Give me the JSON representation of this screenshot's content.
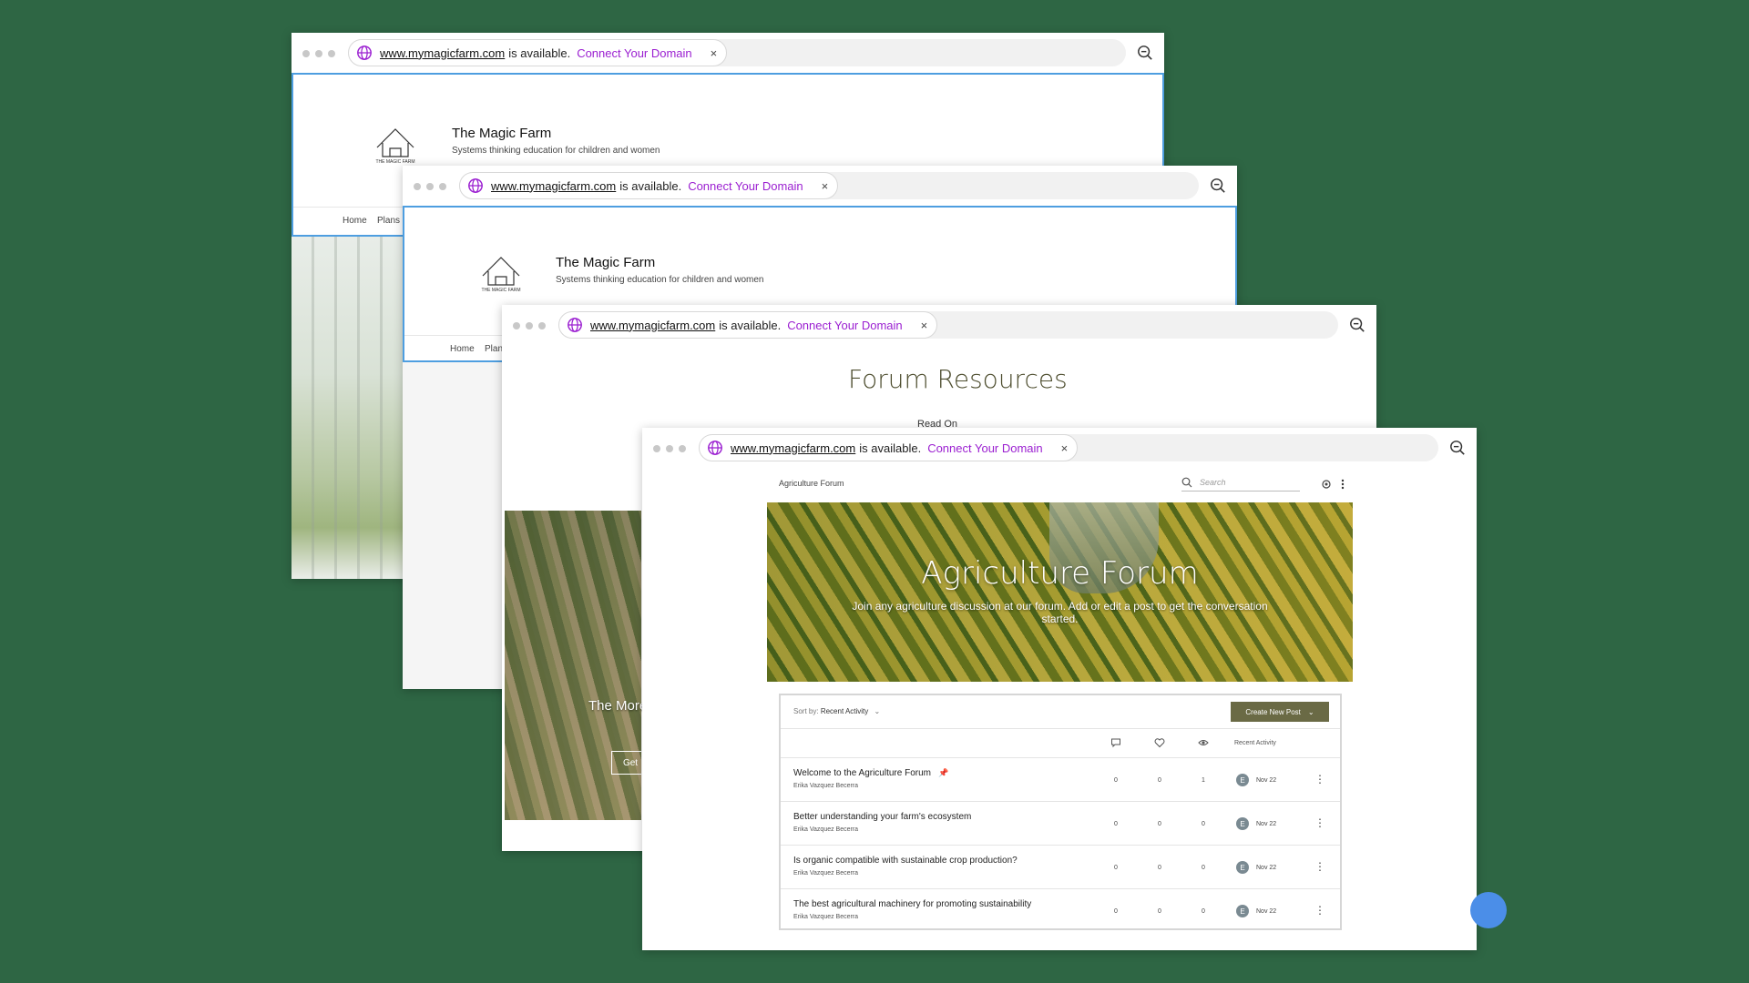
{
  "colors": {
    "background": "#2e6644",
    "accent_connect": "#9b1fd1",
    "button": "#6a6a45"
  },
  "browser": {
    "domain": "www.mymagicfarm.com",
    "available_text": "is available.",
    "connect_label": "Connect Your Domain",
    "close_glyph": "×"
  },
  "site": {
    "brand": "The Magic Farm",
    "tagline": "Systems thinking education for children and women",
    "logo_text": "THE MAGIC FARM",
    "nav": [
      "Home",
      "Plans &",
      "Plans"
    ]
  },
  "resources": {
    "title": "Forum Resources",
    "read_on": "Read On",
    "overlay_text": "The More",
    "overlay_button": "Get"
  },
  "forum": {
    "breadcrumb": "Agriculture Forum",
    "search_placeholder": "Search",
    "hero_title": "Agriculture Forum",
    "hero_desc": "Join any agriculture discussion at our forum. Add or edit a post to get the conversation started.",
    "sort_label": "Sort by:",
    "sort_value": "Recent Activity",
    "create_post": "Create New Post",
    "col_recent": "Recent Activity",
    "posts": [
      {
        "title": "Welcome to the Agriculture Forum",
        "author": "Erika Vazquez Becerra",
        "comments": "0",
        "likes": "0",
        "views": "1",
        "avatar": "E",
        "date": "Nov 22",
        "pinned": true
      },
      {
        "title": "Better understanding your farm's ecosystem",
        "author": "Erika Vazquez Becerra",
        "comments": "0",
        "likes": "0",
        "views": "0",
        "avatar": "E",
        "date": "Nov 22",
        "pinned": false
      },
      {
        "title": "Is organic compatible with sustainable crop production?",
        "author": "Erika Vazquez Becerra",
        "comments": "0",
        "likes": "0",
        "views": "0",
        "avatar": "E",
        "date": "Nov 22",
        "pinned": false
      },
      {
        "title": "The best agricultural machinery for promoting sustainability",
        "author": "Erika Vazquez Becerra",
        "comments": "0",
        "likes": "0",
        "views": "0",
        "avatar": "E",
        "date": "Nov 22",
        "pinned": false
      }
    ]
  }
}
